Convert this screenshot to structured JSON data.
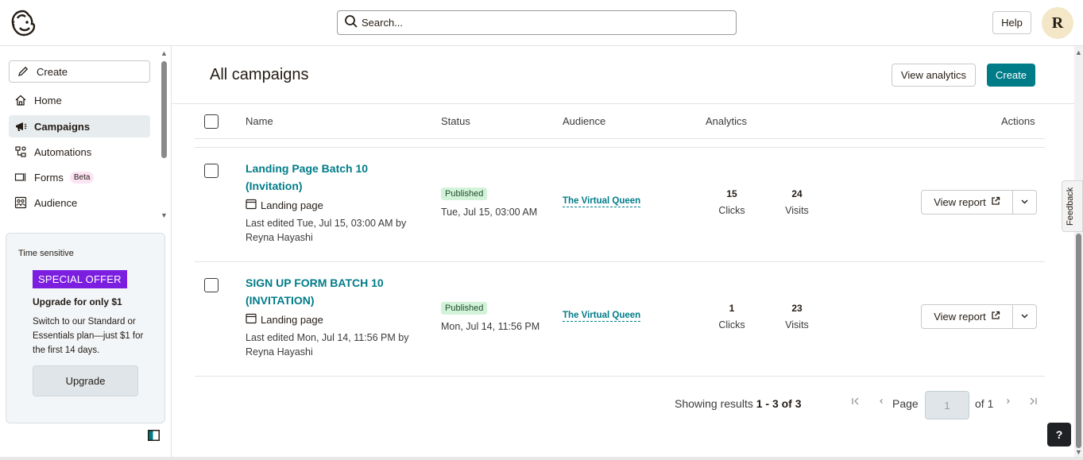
{
  "header": {
    "search_placeholder": "Search...",
    "help_label": "Help",
    "avatar_initial": "R"
  },
  "sidebar": {
    "create_label": "Create",
    "items": [
      {
        "label": "Home",
        "icon": "home-icon"
      },
      {
        "label": "Campaigns",
        "icon": "megaphone-icon",
        "active": true
      },
      {
        "label": "Automations",
        "icon": "automations-icon"
      },
      {
        "label": "Forms",
        "icon": "forms-icon",
        "badge": "Beta"
      },
      {
        "label": "Audience",
        "icon": "audience-icon"
      }
    ],
    "promo": {
      "tag": "Time sensitive",
      "offer": "SPECIAL OFFER",
      "title": "Upgrade for only $1",
      "desc": "Switch to our Standard or Essentials plan—just $1 for the first 14 days.",
      "button": "Upgrade"
    }
  },
  "main": {
    "title": "All campaigns",
    "view_analytics_label": "View analytics",
    "create_label": "Create",
    "columns": {
      "name": "Name",
      "status": "Status",
      "audience": "Audience",
      "analytics": "Analytics",
      "actions": "Actions"
    },
    "rows": [
      {
        "name_line1": "Landing Page Batch 10",
        "name_line2": "(Invitation)",
        "type": "Landing page",
        "edited_line1": "Last edited Tue, Jul 15, 03:00 AM by",
        "edited_line2": "Reyna Hayashi",
        "status": "Published",
        "status_date": "Tue, Jul 15, 03:00 AM",
        "audience": "The Virtual Queen",
        "clicks": "15",
        "clicks_label": "Clicks",
        "visits": "24",
        "visits_label": "Visits",
        "report_label": "View report"
      },
      {
        "name_line1": "SIGN UP FORM BATCH 10",
        "name_line2": "(INVITATION)",
        "type": "Landing page",
        "edited_line1": "Last edited Mon, Jul 14, 11:56 PM by",
        "edited_line2": "Reyna Hayashi",
        "status": "Published",
        "status_date": "Mon, Jul 14, 11:56 PM",
        "audience": "The Virtual Queen",
        "clicks": "1",
        "clicks_label": "Clicks",
        "visits": "23",
        "visits_label": "Visits",
        "report_label": "View report"
      }
    ],
    "pagination": {
      "showing_prefix": "Showing results ",
      "showing_range": "1 - 3 of 3",
      "page_label": "Page",
      "page_value": "1",
      "of_label": "of 1"
    }
  },
  "feedback_label": "Feedback",
  "help_fab": "?",
  "colors": {
    "brand_teal": "#007c89",
    "offer_purple": "#7c1ee0",
    "published_bg": "#d3f3d9"
  }
}
